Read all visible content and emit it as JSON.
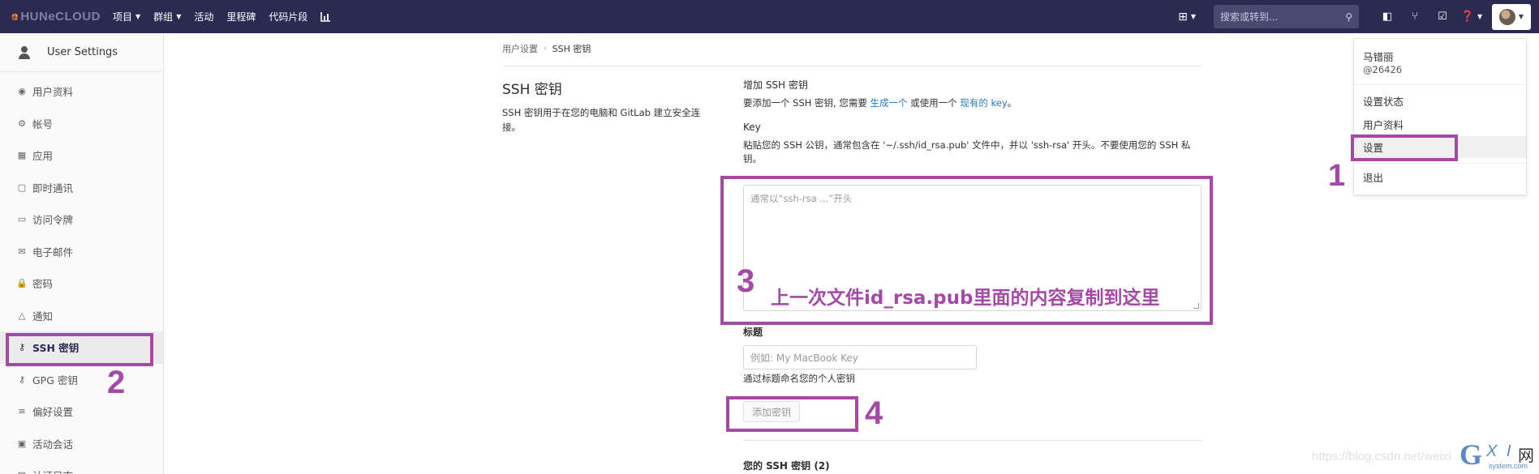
{
  "topbar": {
    "logo_text": "HUNeCLOUD",
    "nav": [
      {
        "label": "项目",
        "has_chevron": true
      },
      {
        "label": "群组",
        "has_chevron": true
      },
      {
        "label": "活动",
        "has_chevron": false
      },
      {
        "label": "里程碑",
        "has_chevron": false
      },
      {
        "label": "代码片段",
        "has_chevron": false
      }
    ],
    "search_placeholder": "搜索或转到...",
    "icons": [
      "chart-icon",
      "plus-icon",
      "search-icon",
      "sidebar-icon",
      "merge-request-icon",
      "todo-icon",
      "help-icon",
      "avatar"
    ]
  },
  "sidebar": {
    "title": "User Settings",
    "items": [
      {
        "label": "用户资料",
        "icon": "profile-icon",
        "glyph": "◉"
      },
      {
        "label": "帐号",
        "icon": "account-icon",
        "glyph": "⚙"
      },
      {
        "label": "应用",
        "icon": "applications-icon",
        "glyph": "▦"
      },
      {
        "label": "即时通讯",
        "icon": "chat-icon",
        "glyph": "▢"
      },
      {
        "label": "访问令牌",
        "icon": "token-icon",
        "glyph": "▭"
      },
      {
        "label": "电子邮件",
        "icon": "email-icon",
        "glyph": "✉"
      },
      {
        "label": "密码",
        "icon": "lock-icon",
        "glyph": "🔒"
      },
      {
        "label": "通知",
        "icon": "bell-icon",
        "glyph": "△"
      },
      {
        "label": "SSH 密钥",
        "icon": "key-icon",
        "glyph": "⚷",
        "active": true
      },
      {
        "label": "GPG 密钥",
        "icon": "key-icon",
        "glyph": "⚷"
      },
      {
        "label": "偏好设置",
        "icon": "preferences-icon",
        "glyph": "≡"
      },
      {
        "label": "活动会话",
        "icon": "monitor-icon",
        "glyph": "▣"
      },
      {
        "label": "认证日志",
        "icon": "log-icon",
        "glyph": "▤"
      }
    ]
  },
  "breadcrumb": {
    "parent": "用户设置",
    "current": "SSH 密钥"
  },
  "left": {
    "title": "SSH 密钥",
    "description": "SSH 密钥用于在您的电脑和 GitLab 建立安全连接。"
  },
  "form": {
    "section_title": "增加 SSH 密钥",
    "intro_pre": "要添加一个 SSH 密钥, 您需要 ",
    "intro_link1": "生成一个",
    "intro_mid": " 或使用一个 ",
    "intro_link2": "现有的 key",
    "intro_post": "。",
    "key_label": "Key",
    "key_help": "粘贴您的 SSH 公钥，通常包含在 '~/.ssh/id_rsa.pub' 文件中，并以 'ssh-rsa' 开头。不要使用您的 SSH 私钥。",
    "key_placeholder": "通常以“ssh-rsa ...”开头",
    "title_label": "标题",
    "title_placeholder": "例如: My MacBook Key",
    "title_help": "通过标题命名您的个人密钥",
    "submit_label": "添加密钥",
    "your_keys_label": "您的 SSH 密钥 (2)"
  },
  "dropdown": {
    "name": "马错丽",
    "handle": "@26426",
    "items": [
      "设置状态",
      "用户资料",
      "设置",
      "退出"
    ],
    "highlighted": "设置"
  },
  "annotations": {
    "n1": "1",
    "n2": "2",
    "n3": "3",
    "n4": "4",
    "text3": "上一次文件id_rsa.pub里面的内容复制到这里",
    "color": "#a44aa6"
  },
  "watermark": {
    "url": "https://blog.csdn.net/weixi",
    "logo_g": "G",
    "logo_xi": "X I",
    "logo_wang": "网",
    "logo_sub": "system.com"
  },
  "colors": {
    "topbar": "#2b2a52",
    "link": "#1f78d1",
    "annotation": "#a44aa6"
  }
}
